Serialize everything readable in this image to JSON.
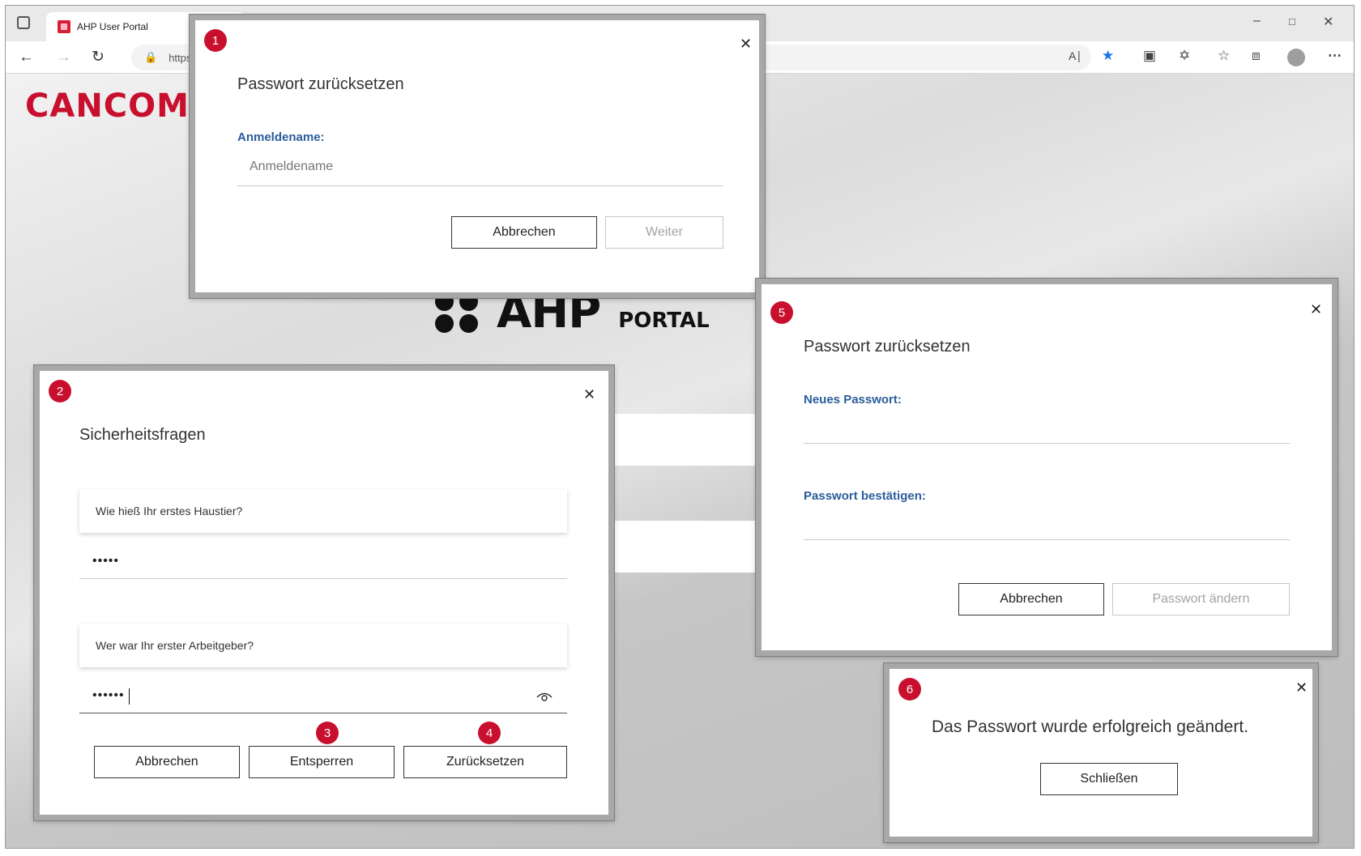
{
  "browser": {
    "tab_title": "AHP User Portal",
    "url_prefix": "https:",
    "icons": [
      "tab-actions-icon",
      "back-icon",
      "forward-icon",
      "refresh-icon",
      "lock-icon",
      "read-aloud-icon",
      "favorite-star-icon",
      "screenshot-icon",
      "extensions-icon",
      "favorites-icon",
      "collections-icon",
      "profile-icon",
      "more-icon",
      "minimize-icon",
      "maximize-icon",
      "close-icon"
    ],
    "accent": "#1a73e8"
  },
  "page": {
    "brand": "CANCOM",
    "ahp_logo": "AHP",
    "ahp_sub": "PORTAL",
    "brand_color": "#c8102e"
  },
  "dialog1": {
    "badge": "1",
    "title": "Passwort zurücksetzen",
    "username_label": "Anmeldename:",
    "username_placeholder": "Anmeldename",
    "cancel": "Abbrechen",
    "next": "Weiter"
  },
  "dialog2": {
    "badge": "2",
    "title": "Sicherheitsfragen",
    "question1": "Wie hieß Ihr erstes Haustier?",
    "answer1_mask": "•••••",
    "question2": "Wer war Ihr erster Arbeitgeber?",
    "answer2_mask": "••••••",
    "badge_unlock": "3",
    "badge_reset": "4",
    "cancel": "Abbrechen",
    "unlock": "Entsperren",
    "reset": "Zurücksetzen"
  },
  "dialog5": {
    "badge": "5",
    "title": "Passwort zurücksetzen",
    "new_password_label": "Neues Passwort:",
    "confirm_password_label": "Passwort bestätigen:",
    "cancel": "Abbrechen",
    "change": "Passwort ändern"
  },
  "dialog6": {
    "badge": "6",
    "message": "Das Passwort wurde erfolgreich geändert.",
    "close_button": "Schließen"
  },
  "badge_color": "#c8102e",
  "label_color": "#2b5d9c"
}
